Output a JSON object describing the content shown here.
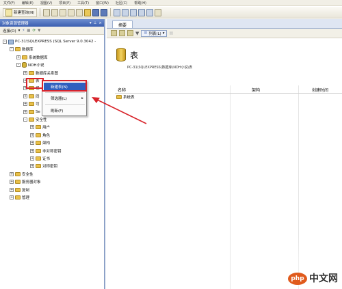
{
  "menubar": {
    "items": [
      "文件(F)",
      "编辑(E)",
      "视图(V)",
      "项目(P)",
      "工具(T)",
      "窗口(W)",
      "社区(C)",
      "帮助(H)"
    ]
  },
  "toolbar": {
    "new_query_label": "新建查询(N)"
  },
  "object_explorer": {
    "title": "对象资源管理器",
    "connect_label": "连接(O)",
    "tree": [
      {
        "label": "PC-31\\SQLEXPRESS (SQL Server 9.0.3042 -",
        "level": 0,
        "kind": "server",
        "expand": "-"
      },
      {
        "label": "数据库",
        "level": 1,
        "kind": "folder",
        "expand": "-"
      },
      {
        "label": "系统数据库",
        "level": 2,
        "kind": "folder",
        "expand": "+"
      },
      {
        "label": "NDH小说",
        "level": 2,
        "kind": "db",
        "expand": "-"
      },
      {
        "label": "数据库关系图",
        "level": 3,
        "kind": "folder",
        "expand": "+"
      },
      {
        "label": "表",
        "level": 3,
        "kind": "folder",
        "expand": "+"
      },
      {
        "label": "视",
        "level": 3,
        "kind": "folder",
        "expand": "+"
      },
      {
        "label": "同",
        "level": 3,
        "kind": "folder",
        "expand": "+"
      },
      {
        "label": "可",
        "level": 3,
        "kind": "folder",
        "expand": "+"
      },
      {
        "label": "Se",
        "level": 3,
        "kind": "folder",
        "expand": "+"
      },
      {
        "label": "安全性",
        "level": 3,
        "kind": "folder",
        "expand": "-"
      },
      {
        "label": "用户",
        "level": 4,
        "kind": "folder",
        "expand": "+"
      },
      {
        "label": "角色",
        "level": 4,
        "kind": "folder",
        "expand": "+"
      },
      {
        "label": "架构",
        "level": 4,
        "kind": "folder",
        "expand": "+"
      },
      {
        "label": "非对称密钥",
        "level": 4,
        "kind": "folder",
        "expand": "+"
      },
      {
        "label": "证书",
        "level": 4,
        "kind": "folder",
        "expand": "+"
      },
      {
        "label": "对称密钥",
        "level": 4,
        "kind": "folder",
        "expand": "+"
      },
      {
        "label": "安全性",
        "level": 1,
        "kind": "folder",
        "expand": "+"
      },
      {
        "label": "服务器对象",
        "level": 1,
        "kind": "folder",
        "expand": "+"
      },
      {
        "label": "复制",
        "level": 1,
        "kind": "folder",
        "expand": "+"
      },
      {
        "label": "管理",
        "level": 1,
        "kind": "folder",
        "expand": "+"
      }
    ]
  },
  "context_menu": {
    "items": [
      {
        "label": "新建表(N)",
        "selected": true,
        "submenu": false
      },
      {
        "label": "筛选器(L)",
        "selected": false,
        "submenu": true
      },
      {
        "label": "刷新(F)",
        "selected": false,
        "submenu": false
      }
    ]
  },
  "summary": {
    "tab_label": "摘要",
    "view_button_label": "列表(L)",
    "heading": "表",
    "path": "PC-31\\SQLEXPRESS\\数据库\\NDH小说\\表",
    "columns": [
      "名称",
      "架构",
      "创建时间"
    ],
    "rows": [
      {
        "name": "系统表"
      }
    ]
  },
  "watermark": {
    "logo": "php",
    "text": "中文网"
  },
  "colors": {
    "annotation_red": "#d8232a",
    "menu_highlight": "#2f5fbf",
    "title_bar": "#3a5eb0"
  }
}
